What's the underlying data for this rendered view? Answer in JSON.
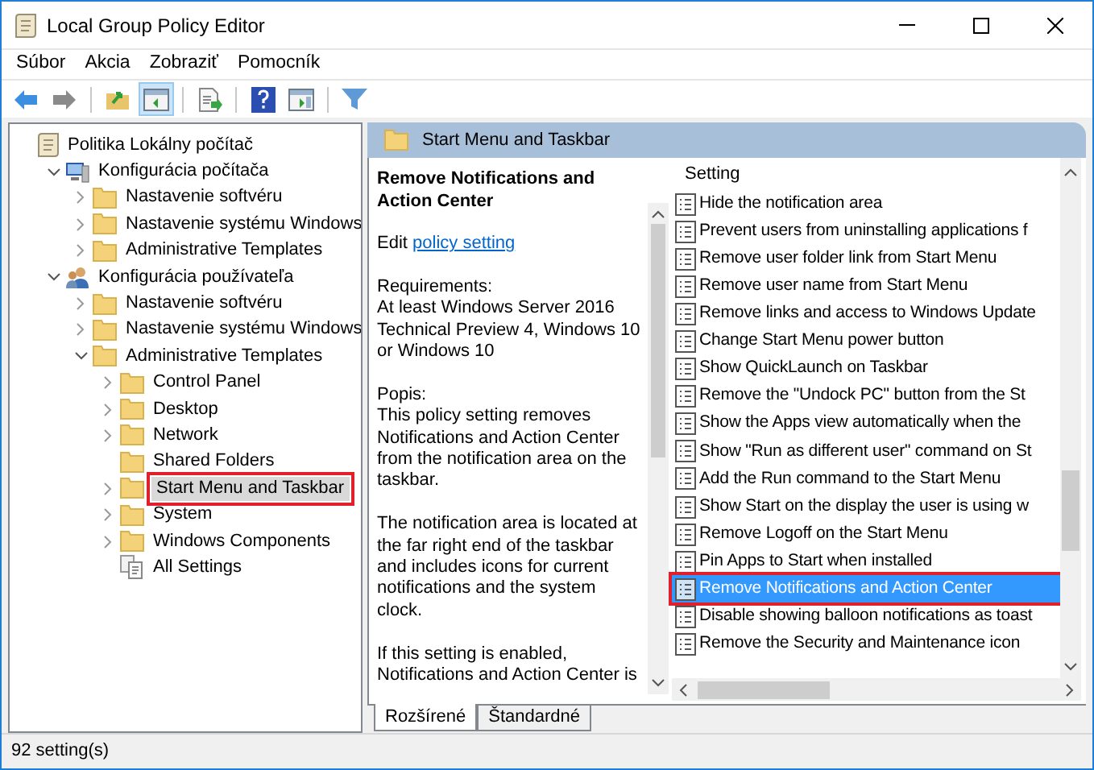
{
  "window": {
    "title": "Local Group Policy Editor"
  },
  "menu": [
    "Súbor",
    "Akcia",
    "Zobraziť",
    "Pomocník"
  ],
  "toolbar": [
    {
      "kind": "back",
      "pressed": false
    },
    {
      "kind": "forward",
      "pressed": false
    },
    {
      "kind": "sep"
    },
    {
      "kind": "up",
      "pressed": false
    },
    {
      "kind": "tree",
      "pressed": true
    },
    {
      "kind": "sep"
    },
    {
      "kind": "export",
      "pressed": false
    },
    {
      "kind": "sep"
    },
    {
      "kind": "help",
      "pressed": false
    },
    {
      "kind": "pane",
      "pressed": false
    },
    {
      "kind": "sep"
    },
    {
      "kind": "filter",
      "pressed": false
    }
  ],
  "tree": [
    {
      "label": "Politika Lokálny počítač",
      "kind": "root",
      "selected": false,
      "children": [
        {
          "label": "Konfigurácia počítača",
          "kind": "computer",
          "expanded": true,
          "selected": false,
          "children": [
            {
              "label": "Nastavenie softvéru",
              "kind": "folder",
              "expanded": false,
              "selected": false
            },
            {
              "label": "Nastavenie systému Windows",
              "kind": "folder",
              "expanded": false,
              "selected": false
            },
            {
              "label": "Administrative Templates",
              "kind": "folder",
              "expanded": false,
              "selected": false
            }
          ]
        },
        {
          "label": "Konfigurácia používateľa",
          "kind": "user",
          "expanded": true,
          "selected": false,
          "children": [
            {
              "label": "Nastavenie softvéru",
              "kind": "folder",
              "expanded": false,
              "selected": false
            },
            {
              "label": "Nastavenie systému Windows",
              "kind": "folder",
              "expanded": false,
              "selected": false
            },
            {
              "label": "Administrative Templates",
              "kind": "folder",
              "expanded": true,
              "selected": false,
              "children": [
                {
                  "label": "Control Panel",
                  "kind": "folder",
                  "expanded": false,
                  "selected": false
                },
                {
                  "label": "Desktop",
                  "kind": "folder",
                  "expanded": false,
                  "selected": false
                },
                {
                  "label": "Network",
                  "kind": "folder",
                  "expanded": false,
                  "selected": false
                },
                {
                  "label": "Shared Folders",
                  "kind": "folder",
                  "selected": false
                },
                {
                  "label": "Start Menu and Taskbar",
                  "kind": "folder",
                  "expanded": false,
                  "selected": true
                },
                {
                  "label": "System",
                  "kind": "folder",
                  "expanded": false,
                  "selected": false
                },
                {
                  "label": "Windows Components",
                  "kind": "folder",
                  "expanded": false,
                  "selected": false
                },
                {
                  "label": "All Settings",
                  "kind": "settings",
                  "selected": false
                }
              ]
            }
          ]
        }
      ]
    }
  ],
  "header": {
    "title": "Start Menu and Taskbar"
  },
  "description": {
    "title": "Remove Notifications and Action Center",
    "edit_prefix": "Edit",
    "edit_link": "policy setting",
    "paragraphs": [
      [
        "Requirements:",
        "At least Windows Server 2016",
        "Technical Preview 4, Windows 10",
        "or Windows 10"
      ],
      [
        "Popis:",
        "This policy setting removes",
        "Notifications and Action Center",
        "from the notification area on the",
        "taskbar."
      ],
      [
        "The notification area is located at",
        "the far right end of the taskbar",
        "and includes icons for current",
        "notifications and the system",
        "clock."
      ],
      [
        "If this setting is enabled,",
        "Notifications and Action Center is"
      ]
    ]
  },
  "settings": {
    "column": "Setting",
    "rows": [
      {
        "label": "Hide the notification area",
        "selected": false
      },
      {
        "label": "Prevent users from uninstalling applications f",
        "selected": false
      },
      {
        "label": "Remove user folder link from Start Menu",
        "selected": false
      },
      {
        "label": "Remove user name from Start Menu",
        "selected": false
      },
      {
        "label": "Remove links and access to Windows Update",
        "selected": false
      },
      {
        "label": "Change Start Menu power button",
        "selected": false
      },
      {
        "label": "Show QuickLaunch on Taskbar",
        "selected": false
      },
      {
        "label": "Remove the \"Undock PC\" button from the St",
        "selected": false
      },
      {
        "label": "Show the Apps view automatically when the",
        "selected": false
      },
      {
        "label": "Show \"Run as different user\" command on St",
        "selected": false
      },
      {
        "label": "Add the Run command to the Start Menu",
        "selected": false
      },
      {
        "label": "Show Start on the display the user is using w",
        "selected": false
      },
      {
        "label": "Remove Logoff on the Start Menu",
        "selected": false
      },
      {
        "label": "Pin Apps to Start when installed",
        "selected": false
      },
      {
        "label": "Remove Notifications and Action Center",
        "selected": true
      },
      {
        "label": "Disable showing balloon notifications as toast",
        "selected": false
      },
      {
        "label": "Remove the Security and Maintenance icon",
        "selected": false
      }
    ]
  },
  "tabs": [
    {
      "label": "Rozšírené",
      "selected": true
    },
    {
      "label": "Štandardné",
      "selected": false
    }
  ],
  "status_bar": {
    "text": "92 setting(s)"
  }
}
